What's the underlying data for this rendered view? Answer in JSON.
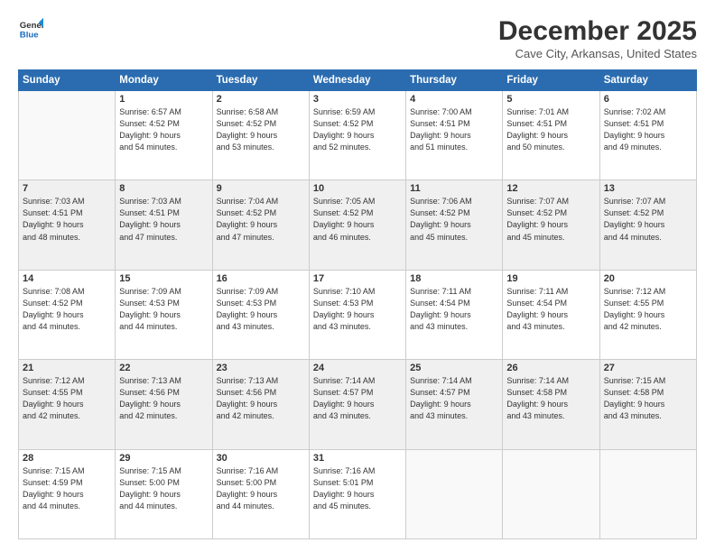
{
  "logo": {
    "line1": "General",
    "line2": "Blue"
  },
  "title": "December 2025",
  "subtitle": "Cave City, Arkansas, United States",
  "headers": [
    "Sunday",
    "Monday",
    "Tuesday",
    "Wednesday",
    "Thursday",
    "Friday",
    "Saturday"
  ],
  "weeks": [
    [
      {
        "day": "",
        "info": ""
      },
      {
        "day": "1",
        "info": "Sunrise: 6:57 AM\nSunset: 4:52 PM\nDaylight: 9 hours\nand 54 minutes."
      },
      {
        "day": "2",
        "info": "Sunrise: 6:58 AM\nSunset: 4:52 PM\nDaylight: 9 hours\nand 53 minutes."
      },
      {
        "day": "3",
        "info": "Sunrise: 6:59 AM\nSunset: 4:52 PM\nDaylight: 9 hours\nand 52 minutes."
      },
      {
        "day": "4",
        "info": "Sunrise: 7:00 AM\nSunset: 4:51 PM\nDaylight: 9 hours\nand 51 minutes."
      },
      {
        "day": "5",
        "info": "Sunrise: 7:01 AM\nSunset: 4:51 PM\nDaylight: 9 hours\nand 50 minutes."
      },
      {
        "day": "6",
        "info": "Sunrise: 7:02 AM\nSunset: 4:51 PM\nDaylight: 9 hours\nand 49 minutes."
      }
    ],
    [
      {
        "day": "7",
        "info": "Sunrise: 7:03 AM\nSunset: 4:51 PM\nDaylight: 9 hours\nand 48 minutes."
      },
      {
        "day": "8",
        "info": "Sunrise: 7:03 AM\nSunset: 4:51 PM\nDaylight: 9 hours\nand 47 minutes."
      },
      {
        "day": "9",
        "info": "Sunrise: 7:04 AM\nSunset: 4:52 PM\nDaylight: 9 hours\nand 47 minutes."
      },
      {
        "day": "10",
        "info": "Sunrise: 7:05 AM\nSunset: 4:52 PM\nDaylight: 9 hours\nand 46 minutes."
      },
      {
        "day": "11",
        "info": "Sunrise: 7:06 AM\nSunset: 4:52 PM\nDaylight: 9 hours\nand 45 minutes."
      },
      {
        "day": "12",
        "info": "Sunrise: 7:07 AM\nSunset: 4:52 PM\nDaylight: 9 hours\nand 45 minutes."
      },
      {
        "day": "13",
        "info": "Sunrise: 7:07 AM\nSunset: 4:52 PM\nDaylight: 9 hours\nand 44 minutes."
      }
    ],
    [
      {
        "day": "14",
        "info": "Sunrise: 7:08 AM\nSunset: 4:52 PM\nDaylight: 9 hours\nand 44 minutes."
      },
      {
        "day": "15",
        "info": "Sunrise: 7:09 AM\nSunset: 4:53 PM\nDaylight: 9 hours\nand 44 minutes."
      },
      {
        "day": "16",
        "info": "Sunrise: 7:09 AM\nSunset: 4:53 PM\nDaylight: 9 hours\nand 43 minutes."
      },
      {
        "day": "17",
        "info": "Sunrise: 7:10 AM\nSunset: 4:53 PM\nDaylight: 9 hours\nand 43 minutes."
      },
      {
        "day": "18",
        "info": "Sunrise: 7:11 AM\nSunset: 4:54 PM\nDaylight: 9 hours\nand 43 minutes."
      },
      {
        "day": "19",
        "info": "Sunrise: 7:11 AM\nSunset: 4:54 PM\nDaylight: 9 hours\nand 43 minutes."
      },
      {
        "day": "20",
        "info": "Sunrise: 7:12 AM\nSunset: 4:55 PM\nDaylight: 9 hours\nand 42 minutes."
      }
    ],
    [
      {
        "day": "21",
        "info": "Sunrise: 7:12 AM\nSunset: 4:55 PM\nDaylight: 9 hours\nand 42 minutes."
      },
      {
        "day": "22",
        "info": "Sunrise: 7:13 AM\nSunset: 4:56 PM\nDaylight: 9 hours\nand 42 minutes."
      },
      {
        "day": "23",
        "info": "Sunrise: 7:13 AM\nSunset: 4:56 PM\nDaylight: 9 hours\nand 42 minutes."
      },
      {
        "day": "24",
        "info": "Sunrise: 7:14 AM\nSunset: 4:57 PM\nDaylight: 9 hours\nand 43 minutes."
      },
      {
        "day": "25",
        "info": "Sunrise: 7:14 AM\nSunset: 4:57 PM\nDaylight: 9 hours\nand 43 minutes."
      },
      {
        "day": "26",
        "info": "Sunrise: 7:14 AM\nSunset: 4:58 PM\nDaylight: 9 hours\nand 43 minutes."
      },
      {
        "day": "27",
        "info": "Sunrise: 7:15 AM\nSunset: 4:58 PM\nDaylight: 9 hours\nand 43 minutes."
      }
    ],
    [
      {
        "day": "28",
        "info": "Sunrise: 7:15 AM\nSunset: 4:59 PM\nDaylight: 9 hours\nand 44 minutes."
      },
      {
        "day": "29",
        "info": "Sunrise: 7:15 AM\nSunset: 5:00 PM\nDaylight: 9 hours\nand 44 minutes."
      },
      {
        "day": "30",
        "info": "Sunrise: 7:16 AM\nSunset: 5:00 PM\nDaylight: 9 hours\nand 44 minutes."
      },
      {
        "day": "31",
        "info": "Sunrise: 7:16 AM\nSunset: 5:01 PM\nDaylight: 9 hours\nand 45 minutes."
      },
      {
        "day": "",
        "info": ""
      },
      {
        "day": "",
        "info": ""
      },
      {
        "day": "",
        "info": ""
      }
    ]
  ]
}
